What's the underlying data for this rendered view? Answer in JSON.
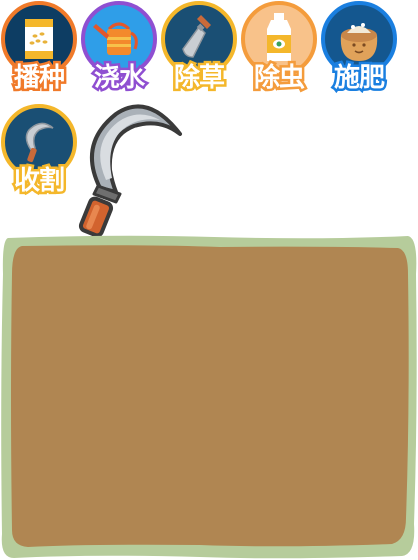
{
  "toolbar": {
    "tools": [
      {
        "id": "sow",
        "label": "播种",
        "icon": "seed-bag-icon",
        "ring_color": "#f07a2a"
      },
      {
        "id": "water",
        "label": "浇水",
        "icon": "watering-can-icon",
        "ring_color": "#8f4fd1"
      },
      {
        "id": "weed",
        "label": "除草",
        "icon": "trowel-icon",
        "ring_color": "#f4b72b"
      },
      {
        "id": "pest",
        "label": "除虫",
        "icon": "pesticide-bottle-icon",
        "ring_color": "#f49c3c"
      },
      {
        "id": "fertilize",
        "label": "施肥",
        "icon": "fertilizer-sack-icon",
        "ring_color": "#1a7fe0"
      },
      {
        "id": "harvest",
        "label": "收割",
        "icon": "sickle-icon",
        "ring_color": "#f4b72b"
      }
    ]
  },
  "cursor": {
    "icon": "sickle-icon"
  },
  "field": {
    "soil_color": "#b08652",
    "border_color": "#a9c98a"
  }
}
